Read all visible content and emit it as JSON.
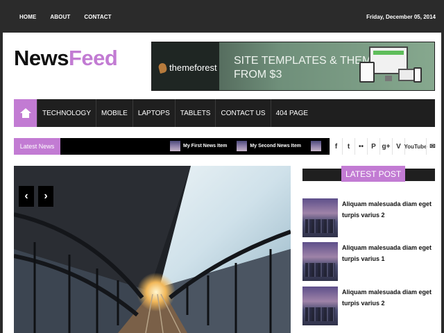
{
  "topbar": {
    "nav": [
      "HOME",
      "ABOUT",
      "CONTACT"
    ],
    "date": "Friday, December 05, 2014"
  },
  "logo": {
    "part1": "News",
    "part2": "Feed"
  },
  "banner": {
    "brand": "themeforest",
    "line1": "SITE TEMPLATES & THEMES",
    "line2": "FROM $3"
  },
  "menu": {
    "items": [
      "TECHNOLOGY",
      "MOBILE",
      "LAPTOPS",
      "TABLETS",
      "CONTACT US",
      "404 PAGE"
    ]
  },
  "ticker": {
    "label": "Latest News",
    "items": [
      "My First News Item",
      "My Second News Item"
    ]
  },
  "social": {
    "icons": [
      "facebook-icon",
      "twitter-icon",
      "flickr-icon",
      "pinterest-icon",
      "google-plus-icon",
      "vimeo-icon",
      "youtube-icon",
      "email-icon"
    ],
    "glyphs": [
      "f",
      "t",
      "••",
      "P",
      "g+",
      "V",
      "YouTube",
      "✉"
    ]
  },
  "slider": {
    "prev": "‹",
    "next": "›"
  },
  "sidebar": {
    "heading": "LATEST POST",
    "posts": [
      "Aliquam malesuada diam eget turpis varius 2",
      "Aliquam malesuada diam eget turpis varius 1",
      "Aliquam malesuada diam eget turpis varius 2"
    ]
  },
  "colors": {
    "accent": "#c27bd3",
    "dark": "#1f1f1f",
    "topbar": "#2b2b2b"
  }
}
